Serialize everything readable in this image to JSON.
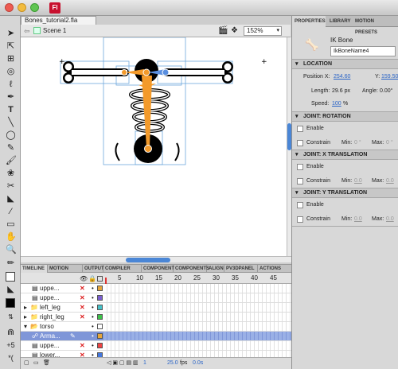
{
  "window": {
    "title": "Bones_tutorial2.fla",
    "app_icon": "Fl"
  },
  "scene": {
    "label": "Scene 1",
    "zoom": "152%"
  },
  "timeline": {
    "tabs": [
      "TIMELINE",
      "MOTION EDITO",
      "OUTPUT",
      "COMPILER ERR",
      "COMPONENT I",
      "COMPONENTS",
      "ALIGN",
      "PV3DPANEL",
      "ACTIONS"
    ],
    "frame_numbers": [
      "5",
      "10",
      "15",
      "20",
      "25",
      "30",
      "35",
      "40",
      "45"
    ],
    "layers": [
      {
        "name": "uppe...",
        "indent": 1,
        "type": "layer",
        "x": true,
        "color": "#e6a63c"
      },
      {
        "name": "uppe...",
        "indent": 1,
        "type": "layer",
        "x": true,
        "color": "#7a5fd0"
      },
      {
        "name": "left_leg",
        "indent": 0,
        "type": "folder",
        "x": true,
        "color": "#46c1c8"
      },
      {
        "name": "right_leg",
        "indent": 0,
        "type": "folder",
        "x": true,
        "color": "#3ec24b"
      },
      {
        "name": "torso",
        "indent": 0,
        "type": "folder-open",
        "x": false,
        "color": ""
      },
      {
        "name": "Arma...",
        "indent": 1,
        "type": "armature",
        "x": false,
        "color": "#e6a63c",
        "selected": true
      },
      {
        "name": "uppe...",
        "indent": 1,
        "type": "layer",
        "x": true,
        "color": "#ee4444"
      },
      {
        "name": "lower...",
        "indent": 1,
        "type": "layer",
        "x": true,
        "color": "#4477dd"
      }
    ],
    "fps": "25.0",
    "fps_unit": "fps",
    "time": "0.0s"
  },
  "properties": {
    "tabs": [
      "PROPERTIES",
      "LIBRARY",
      "MOTION PRESETS"
    ],
    "object_type": "IK Bone",
    "instance_name": "IkBoneName4",
    "location_header": "LOCATION",
    "position_x_label": "Position X:",
    "position_x": "254.60",
    "position_y_label": "Y:",
    "position_y": "159.50",
    "length_label": "Length:",
    "length": "29.6 px",
    "angle_label": "Angle:",
    "angle": "0.00°",
    "speed_label": "Speed:",
    "speed": "100",
    "speed_unit": "%",
    "joint_rotation": "JOINT: ROTATION",
    "joint_x": "JOINT: X TRANSLATION",
    "joint_y": "JOINT: Y TRANSLATION",
    "enable_label": "Enable",
    "constrain_label": "Constrain",
    "min_label": "Min:",
    "max_label": "Max:",
    "rot_min": "0 °",
    "rot_max": "0 °",
    "tx_min": "0.0",
    "tx_max": "0.0",
    "ty_min": "0.0",
    "ty_max": "0.0"
  }
}
